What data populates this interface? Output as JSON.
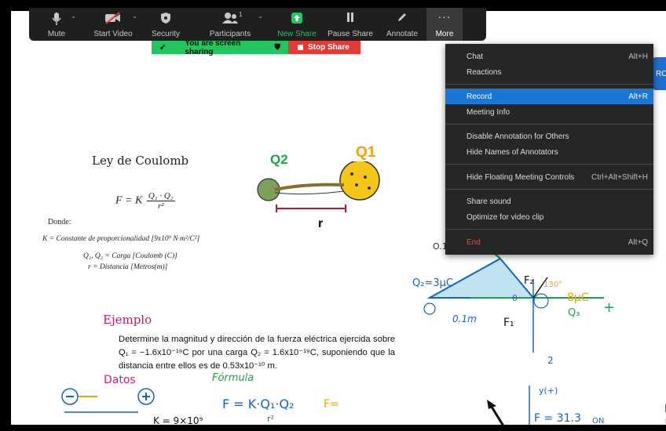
{
  "toolbar": {
    "items": [
      {
        "label": "Mute",
        "icon": "microphone-icon"
      },
      {
        "label": "Start Video",
        "icon": "video-off-icon"
      },
      {
        "label": "Security",
        "icon": "shield-icon"
      },
      {
        "label": "Participants",
        "icon": "participants-icon",
        "count": "1"
      },
      {
        "label": "New Share",
        "icon": "share-up-arrow-icon"
      },
      {
        "label": "Pause Share",
        "icon": "pause-icon"
      },
      {
        "label": "Annotate",
        "icon": "pencil-icon"
      },
      {
        "label": "More",
        "icon": "more-dots-icon"
      }
    ]
  },
  "banner": {
    "sharing_text": "You are screen sharing",
    "stop_label": "Stop Share"
  },
  "menu": {
    "items": [
      {
        "label": "Chat",
        "shortcut": "Alt+H"
      },
      {
        "label": "Reactions",
        "shortcut": ""
      },
      {
        "label": "Record",
        "shortcut": "Alt+R"
      },
      {
        "label": "Meeting Info",
        "shortcut": ""
      },
      {
        "label": "Disable Annotation for Others",
        "shortcut": ""
      },
      {
        "label": "Hide Names of Annotators",
        "shortcut": ""
      },
      {
        "label": "Hide Floating Meeting Controls",
        "shortcut": "Ctrl+Alt+Shift+H"
      },
      {
        "label": "Share sound",
        "shortcut": ""
      },
      {
        "label": "Optimize for video clip",
        "shortcut": ""
      },
      {
        "label": "End",
        "shortcut": "Alt+Q"
      }
    ]
  },
  "slide": {
    "title": "Ley de Coulomb",
    "formula": "F = K",
    "formula_num": "Q₁ · Q₂",
    "formula_den": "r²",
    "donde": "Donde:",
    "def_k": "K = Constante de proporcionalidad [9x10⁹ N·m²/C²]",
    "def_q": "Q₁, Q₂ = Carga [Coulomb (C)]",
    "def_r": "r = Distancia [Metros(m)]",
    "q1_label": "Q1",
    "q2_label": "Q2",
    "r_label": "r",
    "ejemplo": "Ejemplo",
    "problem": "Determine la magnitud y dirección de la fuerza eléctrica ejercida sobre Q₁ = −1.6x10⁻¹⁹C por una carga Q₂ = 1.6x10⁻¹⁹C, suponiendo que la distancia entre ellos es de 0.53x10⁻¹⁰ m."
  },
  "annotations": {
    "datos": "Datos",
    "formula": "Fórmula",
    "f_eq": "F = K·Q₁·Q₂",
    "f_den": "r²",
    "f_small": "F=",
    "k_val": "K = 9×10⁹",
    "q2_3uc": "Q₂=3μC",
    "q1_lbl": "Q₁",
    "q3_8uc": "8μC",
    "q3_lbl": "Q₃",
    "f1": "F₁",
    "f2": "F₂",
    "angle": "130°",
    "theta": "θ",
    "dist": "0.1m",
    "dist2": "O.1",
    "force_val": "F = 31.3",
    "force_sub": "ON",
    "y_lbl": "y(+)",
    "plus_x": "+",
    "right_f": "F",
    "right_f2": "F =",
    "neg_2": "2"
  },
  "edge_tab": "RC",
  "right_text": [
    "n",
    "cu",
    "a l"
  ],
  "colors": {
    "accent": "#1976d2",
    "share_green": "#22c55e",
    "stop_red": "#e53935",
    "ejemplo": "#c01870"
  }
}
